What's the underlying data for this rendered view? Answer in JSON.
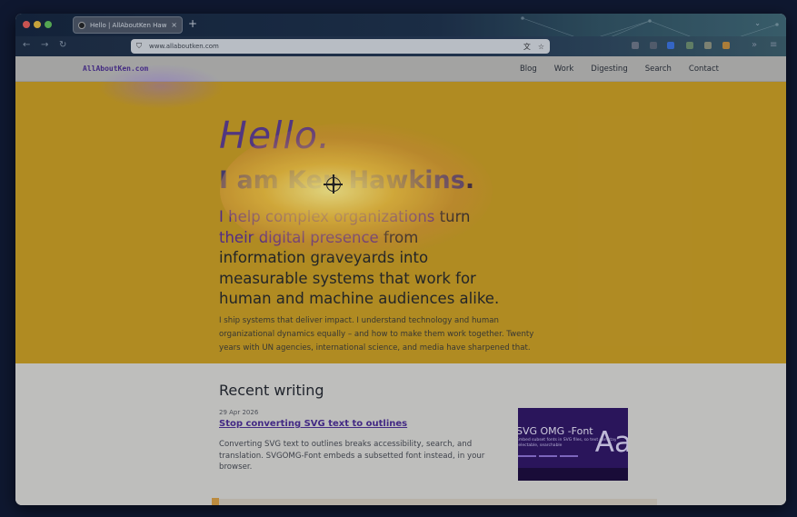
{
  "browser": {
    "tab_title": "Hello | AllAboutKen Hawkins",
    "tab_close": "×",
    "new_tab": "+",
    "tabs_menu": "⌄",
    "url": "www.allaboutken.com",
    "back": "←",
    "forward": "→",
    "reload": "↻",
    "shield_icon": "⛉",
    "translate_icon": "文",
    "bookmark_icon": "☆",
    "overflow": "»",
    "menu": "≡"
  },
  "site": {
    "logo": "AllAboutKen.com",
    "nav": [
      "Blog",
      "Work",
      "Digesting",
      "Search",
      "Contact"
    ]
  },
  "hero": {
    "hello": "Hello.",
    "iam": "I am Ken Hawkins",
    "iam_dot": ".",
    "lead_accent": "I help complex organizations",
    "lead_accent2": "their digital presence",
    "lead_mid": " turn ",
    "lead_rest1": " from information graveyards into measurable systems that work for human and machine audiences alike.",
    "bio": "I ship systems that deliver impact. I understand technology and human organizational dynamics equally – and how to make them work together. Twenty years with UN agencies, international science, and media have sharpened that."
  },
  "recent": {
    "title": "Recent writing",
    "posts": [
      {
        "date": "29 Apr 2026",
        "title": "Stop converting SVG text to outlines",
        "excerpt": "Converting SVG text to outlines breaks accessibility, search, and translation. SVGOMG-Font embeds a subsetted font instead, in your browser.",
        "thumb_title": "SVG OMG -Font",
        "thumb_sub": "Embed subset fonts in SVG files,\nso text can stay selectable, searchable",
        "thumb_aa": "Aa"
      }
    ]
  },
  "colors": {
    "hero_bg": "#c69a1f",
    "accent_purple": "#5a2d91",
    "link": "#4a2b8f"
  }
}
